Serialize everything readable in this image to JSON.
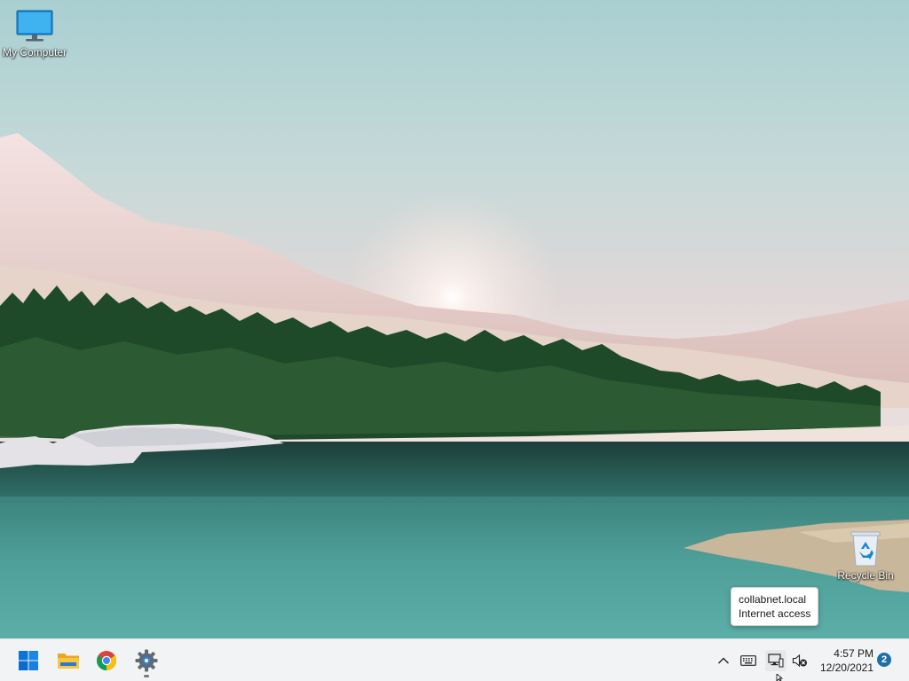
{
  "desktop": {
    "icons": [
      {
        "label": "My Computer",
        "icon": "monitor-icon"
      },
      {
        "label": "Recycle Bin",
        "icon": "recycle-bin-icon"
      }
    ]
  },
  "tooltip": {
    "line1": "collabnet.local",
    "line2": "Internet access"
  },
  "taskbar": {
    "pinned": [
      {
        "name": "Start",
        "icon": "windows-logo-icon"
      },
      {
        "name": "File Explorer",
        "icon": "folder-icon"
      },
      {
        "name": "Google Chrome",
        "icon": "chrome-icon"
      },
      {
        "name": "Settings",
        "icon": "gear-icon",
        "running": true
      }
    ],
    "tray": [
      "chevron-up-icon",
      "keyboard-icon",
      "network-icon",
      "volume-muted-icon"
    ],
    "clock": {
      "time": "4:57 PM",
      "date": "12/20/2021"
    },
    "notification_count": "2"
  },
  "colors": {
    "taskbar_bg": "#f1f3f4",
    "accent": "#0078d4",
    "badge": "#1e6fa8"
  }
}
